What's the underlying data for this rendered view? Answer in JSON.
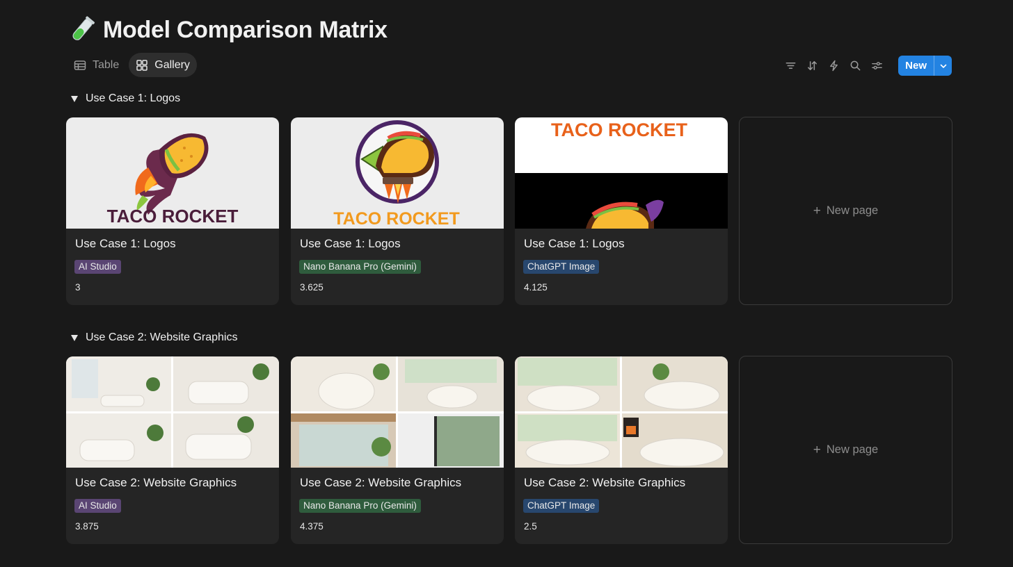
{
  "page": {
    "title": "Model Comparison Matrix"
  },
  "views": [
    {
      "label": "Table",
      "icon": "table-icon",
      "active": false
    },
    {
      "label": "Gallery",
      "icon": "gallery-icon",
      "active": true
    }
  ],
  "toolbar": {
    "icons": [
      "filter-icon",
      "sort-icon",
      "automation-icon",
      "search-icon",
      "settings-icon"
    ],
    "new_label": "New"
  },
  "groups": [
    {
      "label": "Use Case 1: Logos",
      "cards": [
        {
          "name": "Use Case 1: Logos",
          "tag": "AI Studio",
          "score": "3",
          "image_text": "TACO ROCKET"
        },
        {
          "name": "Use Case 1: Logos",
          "tag": "Nano Banana Pro (Gemini)",
          "score": "3.625",
          "image_text": "TACO ROCKET"
        },
        {
          "name": "Use Case 1: Logos",
          "tag": "ChatGPT Image",
          "score": "4.125",
          "image_text": "TACO ROCKET"
        }
      ],
      "new_page_label": "New page"
    },
    {
      "label": "Use Case 2: Website Graphics",
      "cards": [
        {
          "name": "Use Case 2: Website Graphics",
          "tag": "AI Studio",
          "score": "3.875"
        },
        {
          "name": "Use Case 2: Website Graphics",
          "tag": "Nano Banana Pro (Gemini)",
          "score": "4.375"
        },
        {
          "name": "Use Case 2: Website Graphics",
          "tag": "ChatGPT Image",
          "score": "2.5"
        }
      ],
      "new_page_label": "New page"
    }
  ],
  "colors": {
    "background": "#191919",
    "card": "#252525",
    "accent": "#2383e2",
    "tag_ai_studio": "#5a4573",
    "tag_nano_banana": "#2f5c3d",
    "tag_chatgpt": "#28476e"
  }
}
